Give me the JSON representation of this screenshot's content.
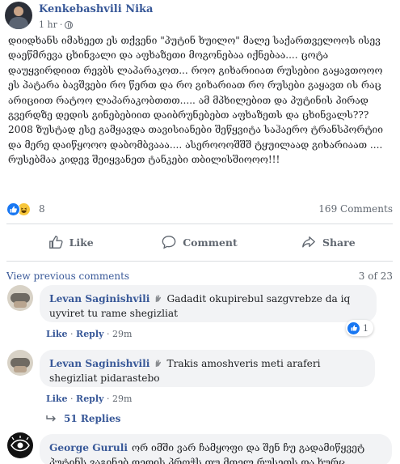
{
  "post": {
    "author": "Kenkebashvili Nika",
    "time": "1 hr",
    "text": "დიიდხანს იმახეეთ ეს თქვენი \"პუტინ ხუილო\" მალე საქართველოოს ისევ დაეწმრევა ცხინვალი და აფხაზეთი მოგონებაა იქნებაა.... ცოტა დაუყვირდიით რევბს ლაპარაკოთ... როო გიხარიიათ რუსებიი გაყავთოოო ეს პატარა ბავშვები რო წერთ და რო გიხარიათ რო რუსები გაყავთ ის რაც არიციით რატოო ლაპარაკობთთთ..... ამ მპხილებით და პუტინის პირად გვერდზე დედის გინებებიით დაიბრუნებებთ აფხაზეთს და ცხინვალს??? 2008 ზუსტად ესე გამყავდა თავისიანები შეწყვიტა საჰაერო ტრანსპორტიი და მერე დაიწყოოო დაბომბვააა.... ასეროოოშშშ ტყუილაად გიხარიაათ .... რუსებმაა კიდევ შეიყვანეთ ტანკები თბილისშიოოო!!!",
    "reactions_count": "8",
    "comments_count": "169 Comments",
    "reaction_icons": [
      "like-icon",
      "haha-icon"
    ]
  },
  "actions": {
    "like": "Like",
    "comment": "Comment",
    "share": "Share"
  },
  "comments_section": {
    "view_previous": "View previous comments",
    "pager": "3 of 23",
    "comments": [
      {
        "name": "Levan Saginishvili",
        "text": "Gadadit okupirebul sazgvrebze da iq uyviret tu rame shegizliat",
        "like": "Like",
        "reply": "Reply",
        "time": "29m",
        "like_count": "1"
      },
      {
        "name": "Levan Saginishvili",
        "text": "Trakis amoshveris meti araferi shegizliat pidarastebo",
        "like": "Like",
        "reply": "Reply",
        "time": "29m"
      },
      {
        "name": "George Guruli",
        "text": "ორ იმში ვარ ჩამყოფი და შენ ჩუ გადამიწყვეტ პუტინს ვაგინებ დედის პროჭს თუ მთელ რუსეთს და ხურც"
      }
    ],
    "replies_label": "51 Replies"
  },
  "colors": {
    "link": "#385898",
    "muted": "#606770",
    "bubble": "#f2f3f5",
    "like_blue": "#1877f2"
  },
  "separator": " · "
}
